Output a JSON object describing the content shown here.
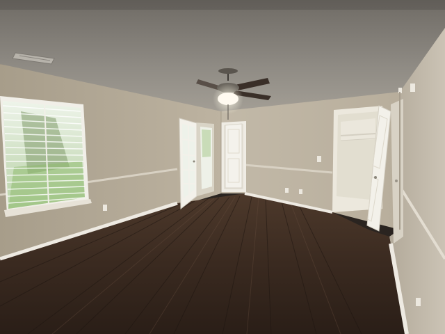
{
  "scene": {
    "description_tags": [
      "empty-room",
      "hardwood-floor",
      "ceiling-fan",
      "window-blinds",
      "french-doors",
      "walk-in-closet"
    ],
    "colors": {
      "ceiling": "#8e8a82",
      "wall_left": "#b6ab98",
      "wall_back": "#bdb3a2",
      "wall_right": "#c4bcae",
      "floor_dark": "#2b1f18",
      "floor_mid": "#4a3628",
      "trim": "#eeeae2",
      "door_white": "#f2f0ea",
      "window_glass": "#d9e8cf"
    }
  }
}
